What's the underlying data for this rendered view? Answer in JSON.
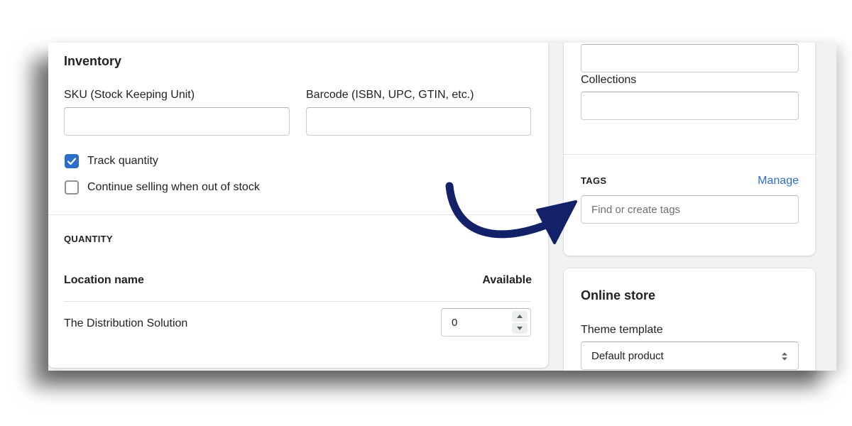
{
  "inventory": {
    "title": "Inventory",
    "sku_label": "SKU (Stock Keeping Unit)",
    "sku_value": "",
    "barcode_label": "Barcode (ISBN, UPC, GTIN, etc.)",
    "barcode_value": "",
    "track_quantity_label": "Track quantity",
    "track_quantity_checked": true,
    "continue_selling_label": "Continue selling when out of stock",
    "continue_selling_checked": false
  },
  "quantity": {
    "heading": "QUANTITY",
    "col_location": "Location name",
    "col_available": "Available",
    "rows": [
      {
        "location": "The Distribution Solution",
        "available": "0"
      }
    ]
  },
  "organization": {
    "collections_label": "Collections",
    "tags_heading": "TAGS",
    "manage_label": "Manage",
    "tags_placeholder": "Find or create tags"
  },
  "online_store": {
    "title": "Online store",
    "theme_template_label": "Theme template",
    "theme_template_value": "Default product"
  },
  "colors": {
    "accent": "#2c6ecb",
    "annotation_arrow": "#132268",
    "page_bg": "#f1f2f3"
  }
}
